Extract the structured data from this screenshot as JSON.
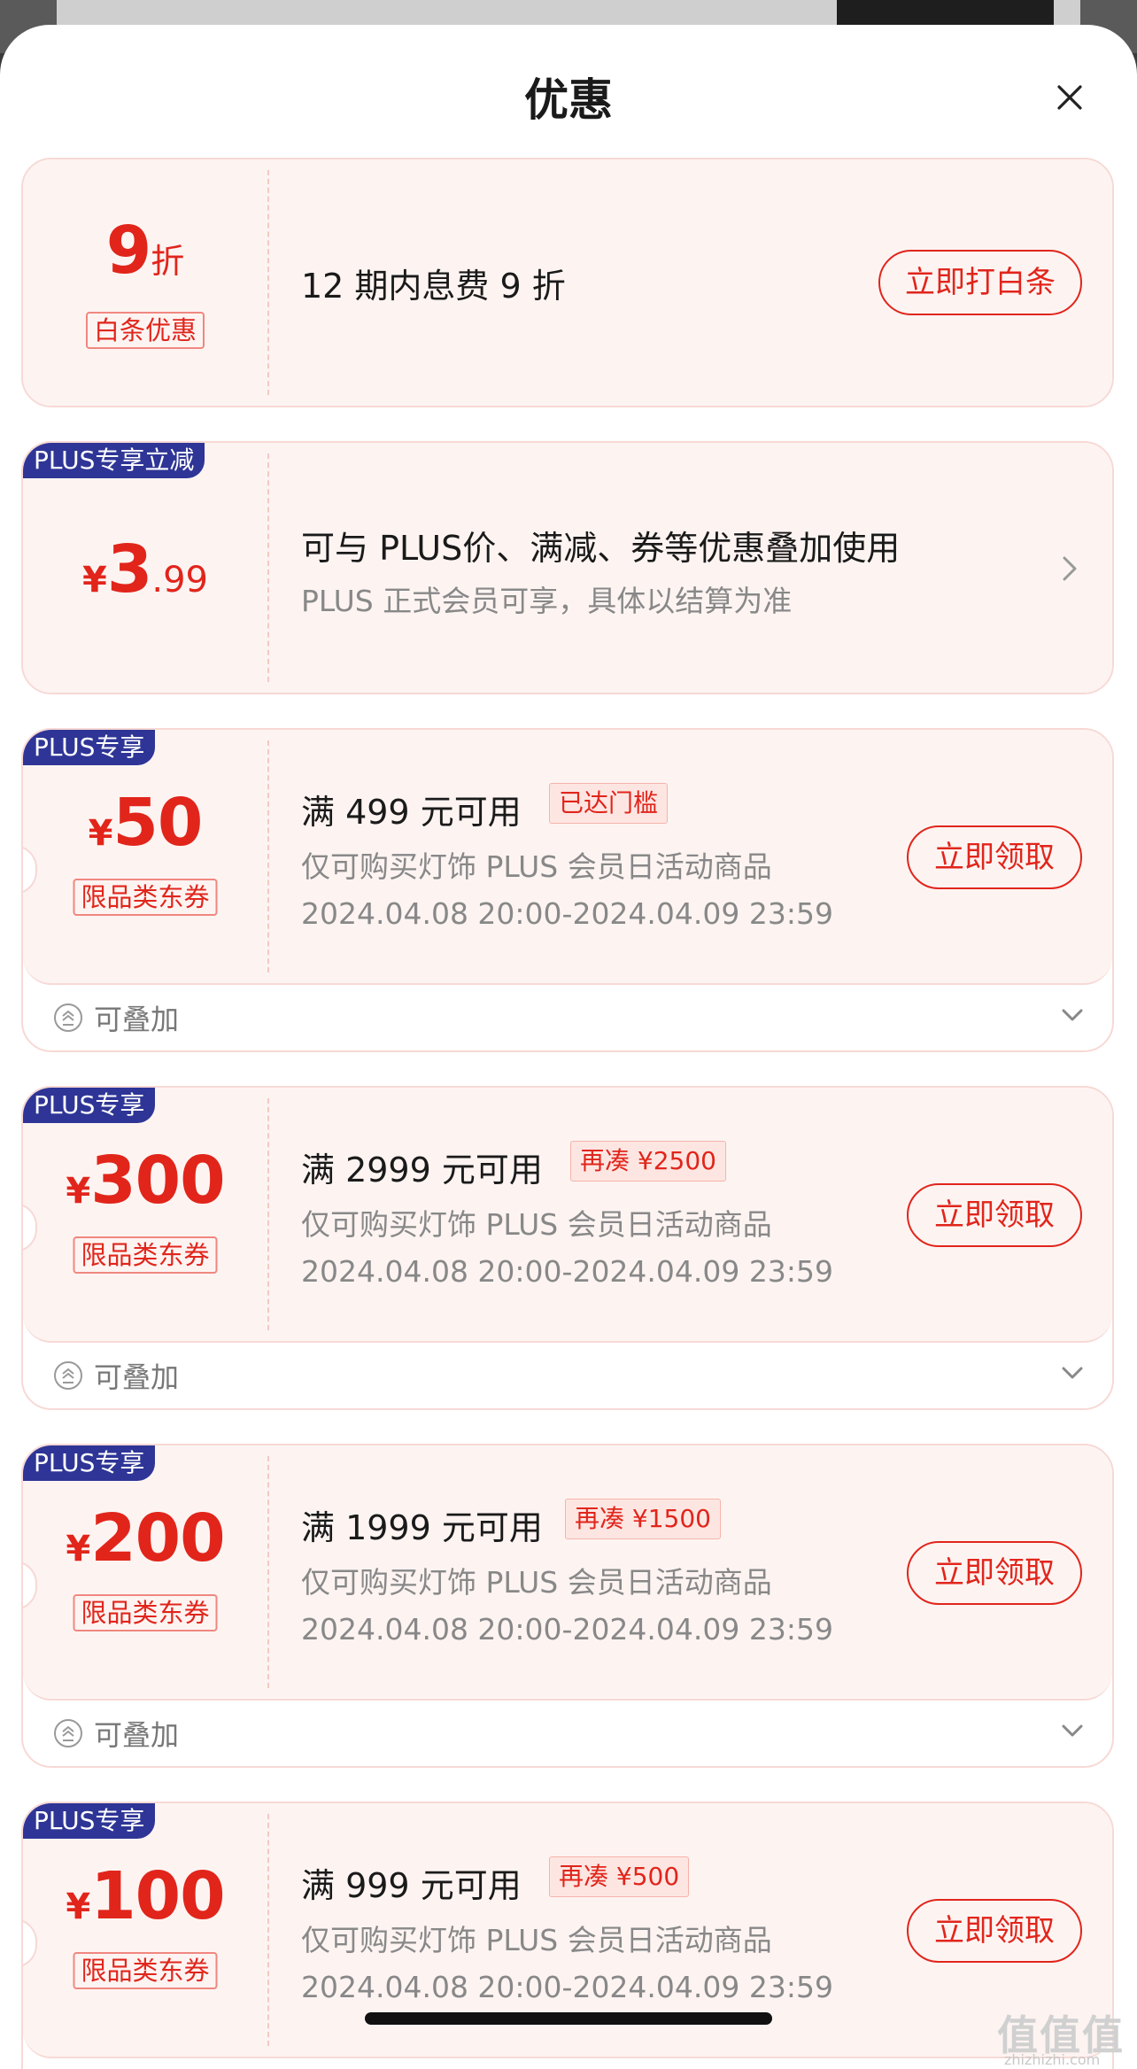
{
  "sheet": {
    "title": "优惠"
  },
  "cards": [
    {
      "type": "baitiao",
      "value": "9",
      "unit": "折",
      "tag": "白条优惠",
      "desc": "12 期内息费 9 折",
      "button": "立即打白条"
    },
    {
      "type": "plus_discount",
      "badge": "PLUS专享立减",
      "currency": "¥",
      "integer": "3",
      "decimal": ".99",
      "title": "可与 PLUS价、满减、券等优惠叠加使用",
      "subtitle": "PLUS 正式会员可享，具体以结算为准",
      "icon": "chevron-right-icon"
    },
    {
      "type": "coupon",
      "badge": "PLUS专享",
      "currency": "¥",
      "amount": "50",
      "tag": "限品类东券",
      "condition": "满 499 元可用",
      "threshold": "已达门槛",
      "scope": "仅可购买灯饰 PLUS 会员日活动商品",
      "validity": "2024.04.08 20:00-2024.04.09 23:59",
      "button": "立即领取",
      "stack_label": "可叠加"
    },
    {
      "type": "coupon",
      "badge": "PLUS专享",
      "currency": "¥",
      "amount": "300",
      "tag": "限品类东券",
      "condition": "满 2999 元可用",
      "threshold": "再凑 ¥2500",
      "scope": "仅可购买灯饰 PLUS 会员日活动商品",
      "validity": "2024.04.08 20:00-2024.04.09 23:59",
      "button": "立即领取",
      "stack_label": "可叠加"
    },
    {
      "type": "coupon",
      "badge": "PLUS专享",
      "currency": "¥",
      "amount": "200",
      "tag": "限品类东券",
      "condition": "满 1999 元可用",
      "threshold": "再凑 ¥1500",
      "scope": "仅可购买灯饰 PLUS 会员日活动商品",
      "validity": "2024.04.08 20:00-2024.04.09 23:59",
      "button": "立即领取",
      "stack_label": "可叠加"
    },
    {
      "type": "coupon",
      "badge": "PLUS专享",
      "currency": "¥",
      "amount": "100",
      "tag": "限品类东券",
      "condition": "满 999 元可用",
      "threshold": "再凑 ¥500",
      "scope": "仅可购买灯饰 PLUS 会员日活动商品",
      "validity": "2024.04.08 20:00-2024.04.09 23:59",
      "button": "立即领取"
    }
  ],
  "watermark": {
    "logo": "值值值",
    "site": "zhizhizhi.com"
  },
  "colors": {
    "accent": "#e1251b",
    "plus_badge": "#2e3596",
    "card_bg": "#fdf4f2",
    "card_border": "#f7d9d5"
  }
}
